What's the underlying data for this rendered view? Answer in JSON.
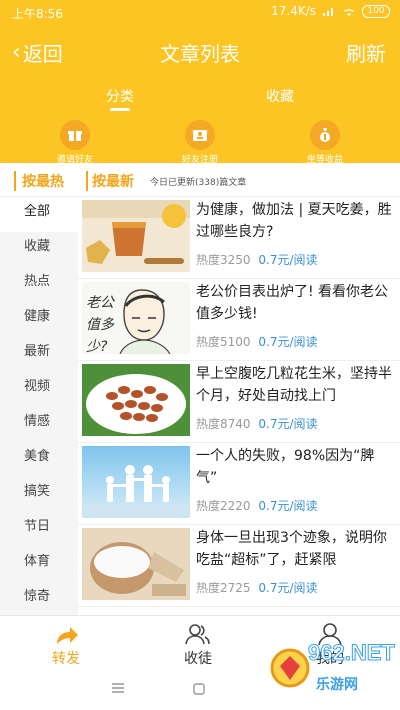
{
  "status": {
    "time": "上午8:56",
    "speed": "17.4K/s",
    "battery": "100"
  },
  "header": {
    "back_label": "返回",
    "title": "文章列表",
    "refresh_label": "刷新"
  },
  "tabs": [
    {
      "label": "分类"
    },
    {
      "label": "收藏"
    }
  ],
  "quick": [
    {
      "label": "邀请好友"
    },
    {
      "label": "好友注册"
    },
    {
      "label": "坐等收益"
    }
  ],
  "sort": {
    "hot": "按最热",
    "new": "按最新",
    "updated": "今日已更新(338)篇文章"
  },
  "sidebar": [
    {
      "label": "全部"
    },
    {
      "label": "收藏"
    },
    {
      "label": "热点"
    },
    {
      "label": "健康"
    },
    {
      "label": "最新"
    },
    {
      "label": "视频"
    },
    {
      "label": "情感"
    },
    {
      "label": "美食"
    },
    {
      "label": "搞笑"
    },
    {
      "label": "节日"
    },
    {
      "label": "体育"
    },
    {
      "label": "惊奇"
    }
  ],
  "articles": [
    {
      "title": "为健康，做加法 | 夏天吃姜，胜过哪些良方?",
      "heat": "热度3250",
      "price": "0.7元/阅读"
    },
    {
      "title": "老公价目表出炉了! 看看你老公值多少钱!",
      "heat": "热度5100",
      "price": "0.7元/阅读"
    },
    {
      "title": "早上空腹吃几粒花生米，坚持半个月，好处自动找上门",
      "heat": "热度8740",
      "price": "0.7元/阅读"
    },
    {
      "title": "一个人的失败，98%因为“脾气”",
      "heat": "热度2220",
      "price": "0.7元/阅读"
    },
    {
      "title": "身体一旦出现3个迹象，说明你吃盐“超标”了，赶紧限",
      "heat": "热度2725",
      "price": "0.7元/阅读"
    }
  ],
  "thumb_text": {
    "husband": "老公值多少?"
  },
  "bottom_nav": [
    {
      "label": "转发"
    },
    {
      "label": "收徒"
    },
    {
      "label": "我的"
    }
  ],
  "watermark": {
    "brand": "962.NET",
    "sub": "乐游网"
  },
  "colors": {
    "accent": "#FCC524",
    "accent_text": "#F3A51C",
    "link": "#3A8FD9"
  },
  "icons": {
    "back": "chevron-left-icon",
    "share": "share-arrow-icon",
    "apprentice": "group-icon",
    "profile": "person-icon",
    "invite": "gift-icon",
    "register": "id-card-icon",
    "earnings": "money-bag-icon"
  }
}
